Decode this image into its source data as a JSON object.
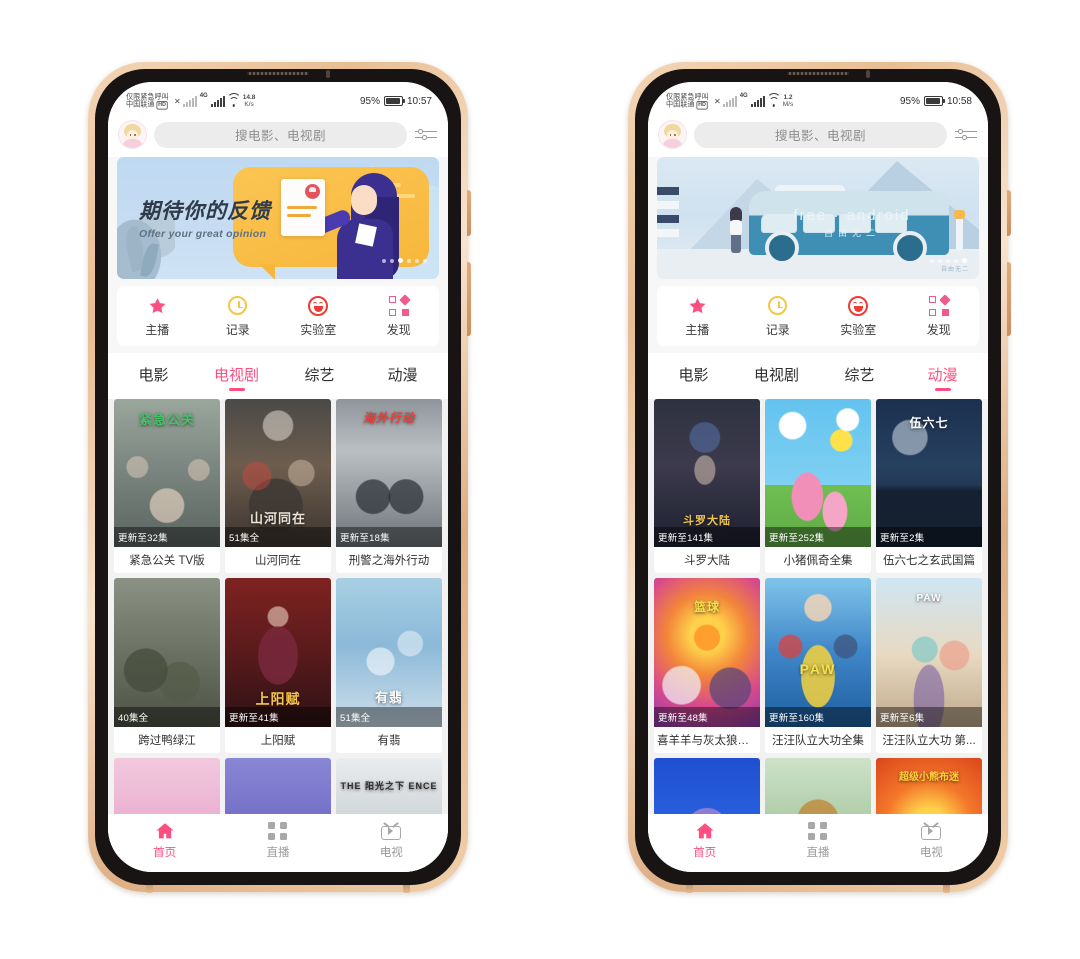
{
  "meta": {
    "background": "#ffffff",
    "accent": "#ff4f81"
  },
  "phones": [
    {
      "id": "phone-left",
      "status": {
        "carrier_line1": "仅限紧急呼叫",
        "carrier_line2": "中国联通",
        "hd_badge": "HD",
        "sim_x": "✕",
        "g_tag": "4G",
        "net_speed_value": "14.8",
        "net_speed_unit": "K/s",
        "battery_percent": "95%",
        "time": "10:57"
      },
      "header": {
        "avatar": "user-avatar",
        "search_placeholder": "搜电影、电视剧",
        "menu": "settings-sliders-icon"
      },
      "banner": {
        "variant": "feedback",
        "title": "期待你的反馈",
        "subtitle": "Offer your great opinion",
        "dots_total": 6,
        "dots_active_index": 2
      },
      "quick_actions": [
        {
          "label": "主播",
          "icon": "star-icon"
        },
        {
          "label": "记录",
          "icon": "clock-icon"
        },
        {
          "label": "实验室",
          "icon": "smiley-icon"
        },
        {
          "label": "发现",
          "icon": "grid-diamond-icon"
        }
      ],
      "category_tabs": [
        {
          "label": "电影",
          "active": false
        },
        {
          "label": "电视剧",
          "active": true
        },
        {
          "label": "综艺",
          "active": false
        },
        {
          "label": "动漫",
          "active": false
        }
      ],
      "cards": [
        {
          "title": "紧急公关 TV版",
          "badge": "更新至32集",
          "poster_text": "紧急公关",
          "poster_text_color": "#48c06a",
          "art": "crowd-drama"
        },
        {
          "title": "山河同在",
          "badge": "51集全",
          "poster_text": "山河同在",
          "poster_text_color": "#e8e2d4",
          "art": "war-era"
        },
        {
          "title": "刑警之海外行动",
          "badge": "更新至18集",
          "poster_text": "海外行动",
          "poster_text_color": "#e8413a",
          "art": "action-grey"
        },
        {
          "title": "跨过鸭绿江",
          "badge": "40集全",
          "poster_text": "",
          "poster_text_color": "#ffffff",
          "art": "battlefield"
        },
        {
          "title": "上阳赋",
          "badge": "更新至41集",
          "poster_text": "上阳赋",
          "poster_text_color": "#f5c64a",
          "art": "royal-red"
        },
        {
          "title": "有翡",
          "badge": "51集全",
          "poster_text": "有翡",
          "poster_text_color": "#ffffff",
          "art": "wuxia-blue"
        },
        {
          "title": "",
          "badge": "",
          "poster_text": "",
          "poster_text_color": "#ffffff",
          "art": "pink-fantasy"
        },
        {
          "title": "",
          "badge": "",
          "poster_text": "",
          "poster_text_color": "#ffffff",
          "art": "purple-lady"
        },
        {
          "title": "",
          "badge": "",
          "poster_text": "THE  阳光之下  ENCE",
          "poster_text_color": "#ffffff",
          "art": "sunlight-noir"
        }
      ],
      "bottom_nav": [
        {
          "label": "首页",
          "icon": "home-icon",
          "active": true
        },
        {
          "label": "直播",
          "icon": "tiles-icon",
          "active": false
        },
        {
          "label": "电视",
          "icon": "tv-icon",
          "active": false
        }
      ]
    },
    {
      "id": "phone-right",
      "status": {
        "carrier_line1": "仅限紧急呼叫",
        "carrier_line2": "中国联通",
        "hd_badge": "HD",
        "sim_x": "✕",
        "g_tag": "4G",
        "net_speed_value": "1.2",
        "net_speed_unit": "M/s",
        "battery_percent": "95%",
        "time": "10:58"
      },
      "header": {
        "avatar": "user-avatar",
        "search_placeholder": "搜电影、电视剧",
        "menu": "settings-sliders-icon"
      },
      "banner": {
        "variant": "van",
        "title": "free · android",
        "subtitle": "自由无二",
        "watermark": "自由无二",
        "dots_total": 5,
        "dots_active_index": 4
      },
      "quick_actions": [
        {
          "label": "主播",
          "icon": "star-icon"
        },
        {
          "label": "记录",
          "icon": "clock-icon"
        },
        {
          "label": "实验室",
          "icon": "smiley-icon"
        },
        {
          "label": "发现",
          "icon": "grid-diamond-icon"
        }
      ],
      "category_tabs": [
        {
          "label": "电影",
          "active": false
        },
        {
          "label": "电视剧",
          "active": false
        },
        {
          "label": "综艺",
          "active": false
        },
        {
          "label": "动漫",
          "active": true
        }
      ],
      "cards": [
        {
          "title": "斗罗大陆",
          "badge": "更新至141集",
          "poster_text": "斗罗大陆",
          "poster_text_color": "#f0c550",
          "art": "anime-dark"
        },
        {
          "title": "小猪佩奇全集",
          "badge": "更新至252集",
          "poster_text": "",
          "poster_text_color": "#ffffff",
          "art": "peppa"
        },
        {
          "title": "伍六七之玄武国篇",
          "badge": "更新至2集",
          "poster_text": "伍六七",
          "poster_text_color": "#ffffff",
          "art": "moon-temple"
        },
        {
          "title": "喜羊羊与灰太狼之...",
          "badge": "更新至48集",
          "poster_text": "篮球",
          "poster_text_color": "#f5e14a",
          "art": "basketball-burst"
        },
        {
          "title": "汪汪队立大功全集",
          "badge": "更新至160集",
          "poster_text": "PAW",
          "poster_text_color": "#f5e14a",
          "art": "paw-patrol"
        },
        {
          "title": "汪汪队立大功 第...",
          "badge": "更新至6集",
          "poster_text": "PAW",
          "poster_text_color": "#ffffff",
          "art": "paw-dino"
        },
        {
          "title": "",
          "badge": "",
          "poster_text": "",
          "poster_text_color": "#ffffff",
          "art": "blue-monster"
        },
        {
          "title": "",
          "badge": "",
          "poster_text": "",
          "poster_text_color": "#ffffff",
          "art": "forest-bear"
        },
        {
          "title": "",
          "badge": "",
          "poster_text": "超级小熊布迷",
          "poster_text_color": "#ffd23c",
          "art": "orange-bear"
        }
      ],
      "bottom_nav": [
        {
          "label": "首页",
          "icon": "home-icon",
          "active": true
        },
        {
          "label": "直播",
          "icon": "tiles-icon",
          "active": false
        },
        {
          "label": "电视",
          "icon": "tv-icon",
          "active": false
        }
      ]
    }
  ]
}
